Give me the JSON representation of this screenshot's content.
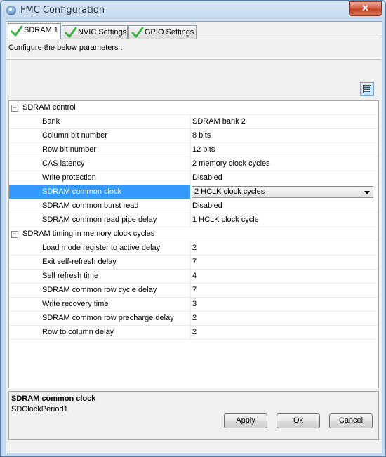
{
  "window": {
    "title": "FMC Configuration",
    "close_glyph": "✕"
  },
  "tabs": [
    {
      "label": "SDRAM 1",
      "active": true
    },
    {
      "label": "NVIC Settings",
      "active": false
    },
    {
      "label": "GPIO Settings",
      "active": false
    }
  ],
  "instructions": "Configure the below parameters :",
  "groups": [
    {
      "label": "SDRAM control",
      "toggle": "−",
      "rows": [
        {
          "name": "Bank",
          "value": "SDRAM bank 2"
        },
        {
          "name": "Column bit number",
          "value": "8 bits"
        },
        {
          "name": "Row bit number",
          "value": "12 bits"
        },
        {
          "name": "CAS latency",
          "value": "2 memory clock cycles"
        },
        {
          "name": "Write protection",
          "value": "Disabled"
        },
        {
          "name": "SDRAM common clock",
          "value": "2 HCLK clock cycles"
        },
        {
          "name": "SDRAM common burst read",
          "value": "Disabled"
        },
        {
          "name": "SDRAM common read pipe delay",
          "value": "1 HCLK clock cycle"
        }
      ]
    },
    {
      "label": "SDRAM timing in memory clock cycles",
      "toggle": "−",
      "rows": [
        {
          "name": "Load mode register to active delay",
          "value": "2"
        },
        {
          "name": "Exit self-refresh delay",
          "value": "7"
        },
        {
          "name": "Self refresh time",
          "value": "4"
        },
        {
          "name": "SDRAM common row cycle delay",
          "value": "7"
        },
        {
          "name": "Write recovery time",
          "value": "3"
        },
        {
          "name": "SDRAM common row precharge delay",
          "value": "2"
        },
        {
          "name": "Row to column delay",
          "value": "2"
        }
      ]
    }
  ],
  "description": {
    "title": "SDRAM common clock",
    "body": "SDClockPeriod1"
  },
  "buttons": {
    "apply": "Apply",
    "ok": "Ok",
    "cancel": "Cancel"
  },
  "colors": {
    "selection": "#3399ff",
    "check": "#3cb043"
  }
}
